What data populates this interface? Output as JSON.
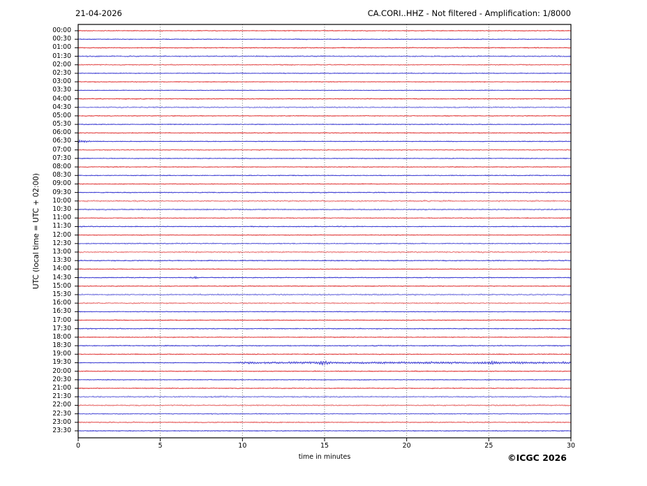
{
  "header": {
    "date": "21-04-2026",
    "title": "CA.CORI..HHZ - Not filtered - Amplification: 1/8000"
  },
  "footer": {
    "copyright": "©ICGC 2026"
  },
  "chart_data": {
    "type": "line",
    "subtype": "helicorder-daily-seismogram",
    "station": "CA.CORI..HHZ",
    "filter_status": "Not filtered",
    "amplification": "1/8000",
    "date": "21-04-2026",
    "xlabel": "time in minutes",
    "ylabel": "UTC (local time = UTC + 02:00)",
    "x_ticks": [
      "0",
      "5",
      "10",
      "15",
      "20",
      "25",
      "30"
    ],
    "xlim": [
      0,
      30
    ],
    "minutes_per_row": 30,
    "grid": "vertical-dotted-at-5min",
    "trace_colors": {
      "red": "#dd2222",
      "blue": "#2222cc"
    },
    "grid_color": "#555555",
    "frame_color": "#000000",
    "rows": [
      {
        "label": "00:00",
        "color": "red",
        "amp": 0.9
      },
      {
        "label": "00:30",
        "color": "blue",
        "amp": 0.8
      },
      {
        "label": "01:00",
        "color": "red",
        "amp": 1.0
      },
      {
        "label": "01:30",
        "color": "blue",
        "amp": 1.3
      },
      {
        "label": "02:00",
        "color": "red",
        "amp": 1.1
      },
      {
        "label": "02:30",
        "color": "blue",
        "amp": 0.8
      },
      {
        "label": "03:00",
        "color": "red",
        "amp": 0.8
      },
      {
        "label": "03:30",
        "color": "blue",
        "amp": 0.7
      },
      {
        "label": "04:00",
        "color": "red",
        "amp": 1.0
      },
      {
        "label": "04:30",
        "color": "blue",
        "amp": 1.4
      },
      {
        "label": "05:00",
        "color": "red",
        "amp": 0.9
      },
      {
        "label": "05:30",
        "color": "blue",
        "amp": 0.8
      },
      {
        "label": "06:00",
        "color": "red",
        "amp": 0.9
      },
      {
        "label": "06:30",
        "color": "blue",
        "amp": 0.8
      },
      {
        "label": "07:00",
        "color": "red",
        "amp": 1.2
      },
      {
        "label": "07:30",
        "color": "blue",
        "amp": 0.8
      },
      {
        "label": "08:00",
        "color": "red",
        "amp": 0.9
      },
      {
        "label": "08:30",
        "color": "blue",
        "amp": 0.8
      },
      {
        "label": "09:00",
        "color": "red",
        "amp": 0.8
      },
      {
        "label": "09:30",
        "color": "blue",
        "amp": 0.9
      },
      {
        "label": "10:00",
        "color": "red",
        "amp": 1.6
      },
      {
        "label": "10:30",
        "color": "blue",
        "amp": 1.2
      },
      {
        "label": "11:00",
        "color": "red",
        "amp": 0.8
      },
      {
        "label": "11:30",
        "color": "blue",
        "amp": 0.9
      },
      {
        "label": "12:00",
        "color": "red",
        "amp": 0.8
      },
      {
        "label": "12:30",
        "color": "blue",
        "amp": 1.1
      },
      {
        "label": "13:00",
        "color": "red",
        "amp": 1.6
      },
      {
        "label": "13:30",
        "color": "blue",
        "amp": 1.0
      },
      {
        "label": "14:00",
        "color": "red",
        "amp": 0.8
      },
      {
        "label": "14:30",
        "color": "blue",
        "amp": 0.9
      },
      {
        "label": "15:00",
        "color": "red",
        "amp": 0.9
      },
      {
        "label": "15:30",
        "color": "blue",
        "amp": 1.5
      },
      {
        "label": "16:00",
        "color": "red",
        "amp": 1.4
      },
      {
        "label": "16:30",
        "color": "blue",
        "amp": 0.8
      },
      {
        "label": "17:00",
        "color": "red",
        "amp": 0.9
      },
      {
        "label": "17:30",
        "color": "blue",
        "amp": 0.9
      },
      {
        "label": "18:00",
        "color": "red",
        "amp": 0.9
      },
      {
        "label": "18:30",
        "color": "blue",
        "amp": 1.0
      },
      {
        "label": "19:00",
        "color": "red",
        "amp": 0.9
      },
      {
        "label": "19:30",
        "color": "blue",
        "amp": 0.9
      },
      {
        "label": "20:00",
        "color": "red",
        "amp": 0.9
      },
      {
        "label": "20:30",
        "color": "blue",
        "amp": 0.8
      },
      {
        "label": "21:00",
        "color": "red",
        "amp": 0.9
      },
      {
        "label": "21:30",
        "color": "blue",
        "amp": 1.6
      },
      {
        "label": "22:00",
        "color": "red",
        "amp": 1.5
      },
      {
        "label": "22:30",
        "color": "blue",
        "amp": 1.1
      },
      {
        "label": "23:00",
        "color": "red",
        "amp": 1.1
      },
      {
        "label": "23:30",
        "color": "blue",
        "amp": 0.9
      }
    ],
    "events": [
      {
        "row": "06:30",
        "type": "burst",
        "start_min": 0.0,
        "end_min": 1.2,
        "amp": 2.6
      },
      {
        "row": "14:30",
        "type": "blip",
        "center_min": 7.1,
        "width_min": 0.18,
        "amp": 2.0
      },
      {
        "row": "19:30",
        "type": "tremor",
        "start_min": 9.3,
        "end_min": 30,
        "amp": 1.2,
        "peaks": [
          {
            "min": 14.9,
            "amp": 2.0,
            "width_min": 0.35
          },
          {
            "min": 25.2,
            "amp": 1.2,
            "width_min": 0.3
          }
        ]
      }
    ]
  }
}
